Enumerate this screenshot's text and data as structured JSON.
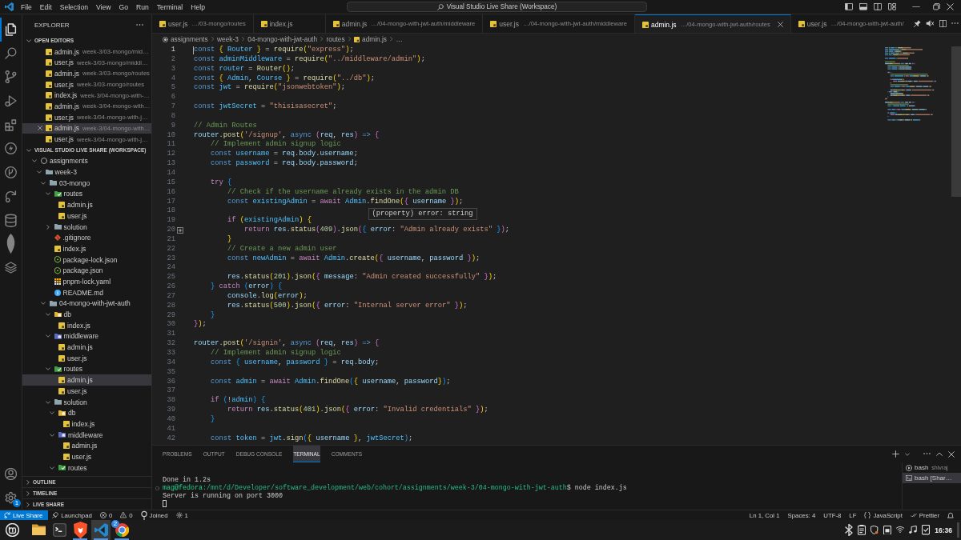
{
  "title_bar": {
    "menu": [
      "File",
      "Edit",
      "Selection",
      "View",
      "Go",
      "Run",
      "Terminal",
      "Help"
    ],
    "command_center": "Visual Studio Live Share (Workspace)"
  },
  "activity_bar": {
    "items": [
      {
        "selected": true
      },
      {
        "selected": false
      },
      {
        "selected": false
      },
      {
        "selected": false
      },
      {
        "selected": false
      },
      {
        "selected": false
      },
      {
        "selected": false
      },
      {
        "selected": false
      },
      {
        "selected": false
      },
      {
        "selected": false
      },
      {
        "selected": false
      }
    ],
    "settings_badge": "1"
  },
  "sidebar": {
    "title": "EXPLORER",
    "open_editors": {
      "title": "OPEN EDITORS",
      "expanded": true,
      "items": [
        {
          "name": "admin.js",
          "path": "week-3/03-mongo/mid…",
          "selected": false
        },
        {
          "name": "user.js",
          "path": "week-3/03-mongo/middl…",
          "selected": false
        },
        {
          "name": "admin.js",
          "path": "week-3/03-mongo/routes",
          "selected": false
        },
        {
          "name": "user.js",
          "path": "week-3/03-mongo/routes",
          "selected": false
        },
        {
          "name": "index.js",
          "path": "week-3/04-mongo-with-…",
          "selected": false
        },
        {
          "name": "admin.js",
          "path": "week-3/04-mongo-with…",
          "selected": false
        },
        {
          "name": "user.js",
          "path": "week-3/04-mongo-with-j…",
          "selected": false
        },
        {
          "name": "admin.js",
          "path": "week-3/04-mongo-with…",
          "selected": true
        },
        {
          "name": "user.js",
          "path": "week-3/04-mongo-with-j…",
          "selected": false
        }
      ]
    },
    "workspace": {
      "title": "VISUAL STUDIO LIVE SHARE (WORKSPACE)",
      "expanded": true,
      "tree": [
        {
          "name": "assignments",
          "kind": "root",
          "expanded": true,
          "selected": false,
          "children": [
            {
              "name": "week-3",
              "kind": "folder",
              "expanded": true,
              "selected": false,
              "children": [
                {
                  "name": "03-mongo",
                  "kind": "folder",
                  "expanded": true,
                  "selected": false,
                  "children": [
                    {
                      "name": "routes",
                      "kind": "routes",
                      "expanded": true,
                      "selected": false,
                      "children": [
                        {
                          "name": "admin.js",
                          "kind": "js",
                          "selected": false
                        },
                        {
                          "name": "user.js",
                          "kind": "js",
                          "selected": false
                        }
                      ]
                    },
                    {
                      "name": "solution",
                      "kind": "folder",
                      "expanded": false,
                      "selected": false
                    },
                    {
                      "name": ".gitignore",
                      "kind": "git",
                      "selected": false
                    },
                    {
                      "name": "index.js",
                      "kind": "js",
                      "selected": false
                    },
                    {
                      "name": "package-lock.json",
                      "kind": "npm",
                      "selected": false
                    },
                    {
                      "name": "package.json",
                      "kind": "npm",
                      "selected": false
                    },
                    {
                      "name": "pnpm-lock.yaml",
                      "kind": "pnpm",
                      "selected": false
                    },
                    {
                      "name": "README.md",
                      "kind": "info",
                      "selected": false
                    }
                  ]
                },
                {
                  "name": "04-mongo-with-jwt-auth",
                  "kind": "folder",
                  "expanded": true,
                  "selected": false,
                  "children": [
                    {
                      "name": "db",
                      "kind": "db",
                      "expanded": true,
                      "selected": false,
                      "children": [
                        {
                          "name": "index.js",
                          "kind": "js",
                          "selected": false
                        }
                      ]
                    },
                    {
                      "name": "middleware",
                      "kind": "middleware",
                      "expanded": true,
                      "selected": false,
                      "children": [
                        {
                          "name": "admin.js",
                          "kind": "js",
                          "selected": false
                        },
                        {
                          "name": "user.js",
                          "kind": "js",
                          "selected": false
                        }
                      ]
                    },
                    {
                      "name": "routes",
                      "kind": "routes",
                      "expanded": true,
                      "selected": false,
                      "children": [
                        {
                          "name": "admin.js",
                          "kind": "js",
                          "selected": true
                        },
                        {
                          "name": "user.js",
                          "kind": "js",
                          "selected": false
                        }
                      ]
                    },
                    {
                      "name": "solution",
                      "kind": "folder",
                      "expanded": true,
                      "selected": false,
                      "children": [
                        {
                          "name": "db",
                          "kind": "db",
                          "expanded": true,
                          "selected": false,
                          "children": [
                            {
                              "name": "index.js",
                              "kind": "js",
                              "selected": false
                            }
                          ]
                        },
                        {
                          "name": "middleware",
                          "kind": "middleware",
                          "expanded": true,
                          "selected": false,
                          "children": [
                            {
                              "name": "admin.js",
                              "kind": "js",
                              "selected": false
                            },
                            {
                              "name": "user.js",
                              "kind": "js",
                              "selected": false
                            }
                          ]
                        },
                        {
                          "name": "routes",
                          "kind": "routes",
                          "expanded": true,
                          "selected": false
                        }
                      ]
                    }
                  ]
                }
              ]
            }
          ]
        }
      ]
    },
    "more_sections": [
      {
        "title": "OUTLINE",
        "expanded": false
      },
      {
        "title": "TIMELINE",
        "expanded": false
      },
      {
        "title": "LIVE SHARE",
        "expanded": false
      }
    ]
  },
  "editor": {
    "tabs": [
      {
        "name": "user.js",
        "path": "…/03-mongo/routes",
        "selected": false
      },
      {
        "name": "index.js",
        "selected": false
      },
      {
        "name": "admin.js",
        "path": "…/04-mongo-with-jwt-auth/middleware",
        "selected": false
      },
      {
        "name": "user.js",
        "path": "…/04-mongo-with-jwt-auth/middleware",
        "selected": false
      },
      {
        "name": "admin.js",
        "path": "…/04-mongo-with-jwt-auth/routes",
        "selected": true
      },
      {
        "name": "user.js",
        "path": "…/04-mongo-with-jwt-auth/",
        "selected": false
      }
    ],
    "breadcrumbs": [
      {
        "text": "assignments",
        "kind": "root"
      },
      {
        "text": "week-3",
        "kind": "folder"
      },
      {
        "text": "04-mongo-with-jwt-auth",
        "kind": "folder"
      },
      {
        "text": "routes",
        "kind": "folder"
      },
      {
        "text": "admin.js",
        "kind": "js"
      },
      {
        "text": "…",
        "kind": "symbol"
      }
    ],
    "lines": [
      {
        "number": "1",
        "active": true,
        "gutter_add": false,
        "tokens": [
          {
            "kind": "keyword",
            "text": "const "
          },
          {
            "kind": "bracket1",
            "text": "{ "
          },
          {
            "kind": "constant",
            "text": "Router "
          },
          {
            "kind": "bracket1",
            "text": "}"
          },
          {
            "kind": "plain",
            "text": " = "
          },
          {
            "kind": "function",
            "text": "require"
          },
          {
            "kind": "bracket1",
            "text": "("
          },
          {
            "kind": "string",
            "text": "\"express\""
          },
          {
            "kind": "bracket1",
            "text": ")"
          },
          {
            "kind": "plain",
            "text": ";"
          }
        ]
      },
      {
        "number": "2",
        "active": false,
        "gutter_add": false,
        "tokens": [
          {
            "kind": "keyword",
            "text": "const "
          },
          {
            "kind": "constant",
            "text": "adminMiddleware"
          },
          {
            "kind": "plain",
            "text": " = "
          },
          {
            "kind": "function",
            "text": "require"
          },
          {
            "kind": "bracket1",
            "text": "("
          },
          {
            "kind": "string",
            "text": "\"../middleware/admin\""
          },
          {
            "kind": "bracket1",
            "text": ")"
          },
          {
            "kind": "plain",
            "text": ";"
          }
        ]
      },
      {
        "number": "3",
        "active": false,
        "gutter_add": false,
        "tokens": [
          {
            "kind": "keyword",
            "text": "const "
          },
          {
            "kind": "constant",
            "text": "router"
          },
          {
            "kind": "plain",
            "text": " = "
          },
          {
            "kind": "function",
            "text": "Router"
          },
          {
            "kind": "bracket1",
            "text": "()"
          },
          {
            "kind": "plain",
            "text": ";"
          }
        ]
      },
      {
        "number": "4",
        "active": false,
        "gutter_add": false,
        "tokens": [
          {
            "kind": "keyword",
            "text": "const "
          },
          {
            "kind": "bracket1",
            "text": "{ "
          },
          {
            "kind": "constant",
            "text": "Admin"
          },
          {
            "kind": "plain",
            "text": ", "
          },
          {
            "kind": "constant",
            "text": "Course "
          },
          {
            "kind": "bracket1",
            "text": "}"
          },
          {
            "kind": "plain",
            "text": " = "
          },
          {
            "kind": "function",
            "text": "require"
          },
          {
            "kind": "bracket1",
            "text": "("
          },
          {
            "kind": "string",
            "text": "\"../db\""
          },
          {
            "kind": "bracket1",
            "text": ")"
          },
          {
            "kind": "plain",
            "text": ";"
          }
        ]
      },
      {
        "number": "5",
        "active": false,
        "gutter_add": false,
        "tokens": [
          {
            "kind": "keyword",
            "text": "const "
          },
          {
            "kind": "constant",
            "text": "jwt"
          },
          {
            "kind": "plain",
            "text": " = "
          },
          {
            "kind": "function",
            "text": "require"
          },
          {
            "kind": "bracket1",
            "text": "("
          },
          {
            "kind": "string",
            "text": "\"jsonwebtoken\""
          },
          {
            "kind": "bracket1",
            "text": ")"
          },
          {
            "kind": "plain",
            "text": ";"
          }
        ]
      },
      {
        "number": "6",
        "active": false,
        "gutter_add": false
      },
      {
        "number": "7",
        "active": false,
        "gutter_add": false,
        "tokens": [
          {
            "kind": "keyword",
            "text": "const "
          },
          {
            "kind": "constant",
            "text": "jwtSecret"
          },
          {
            "kind": "plain",
            "text": " = "
          },
          {
            "kind": "string",
            "text": "\"thisisasecret\""
          },
          {
            "kind": "plain",
            "text": ";"
          }
        ]
      },
      {
        "number": "8",
        "active": false,
        "gutter_add": false
      },
      {
        "number": "9",
        "active": false,
        "gutter_add": false,
        "tokens": [
          {
            "kind": "comment",
            "text": "// Admin Routes"
          }
        ]
      },
      {
        "number": "10",
        "active": false,
        "gutter_add": false,
        "tokens": [
          {
            "kind": "variable",
            "text": "router"
          },
          {
            "kind": "plain",
            "text": "."
          },
          {
            "kind": "function",
            "text": "post"
          },
          {
            "kind": "bracket1",
            "text": "("
          },
          {
            "kind": "string",
            "text": "'/signup'"
          },
          {
            "kind": "plain",
            "text": ", "
          },
          {
            "kind": "keyword",
            "text": "async "
          },
          {
            "kind": "bracket2",
            "text": "("
          },
          {
            "kind": "variable",
            "text": "req"
          },
          {
            "kind": "plain",
            "text": ", "
          },
          {
            "kind": "variable",
            "text": "res"
          },
          {
            "kind": "bracket2",
            "text": ") "
          },
          {
            "kind": "keyword",
            "text": "=> "
          },
          {
            "kind": "bracket2",
            "text": "{"
          }
        ]
      },
      {
        "number": "11",
        "active": false,
        "gutter_add": false,
        "tokens": [
          {
            "kind": "comment",
            "text": "    // Implement admin signup logic"
          }
        ]
      },
      {
        "number": "12",
        "active": false,
        "gutter_add": false,
        "tokens": [
          {
            "kind": "keyword",
            "text": "    const "
          },
          {
            "kind": "constant",
            "text": "username"
          },
          {
            "kind": "plain",
            "text": " = "
          },
          {
            "kind": "variable",
            "text": "req"
          },
          {
            "kind": "plain",
            "text": "."
          },
          {
            "kind": "variable",
            "text": "body"
          },
          {
            "kind": "plain",
            "text": "."
          },
          {
            "kind": "variable",
            "text": "username"
          },
          {
            "kind": "plain",
            "text": ";"
          }
        ]
      },
      {
        "number": "13",
        "active": false,
        "gutter_add": false,
        "tokens": [
          {
            "kind": "keyword",
            "text": "    const "
          },
          {
            "kind": "constant",
            "text": "password"
          },
          {
            "kind": "plain",
            "text": " = "
          },
          {
            "kind": "variable",
            "text": "req"
          },
          {
            "kind": "plain",
            "text": "."
          },
          {
            "kind": "variable",
            "text": "body"
          },
          {
            "kind": "plain",
            "text": "."
          },
          {
            "kind": "variable",
            "text": "password"
          },
          {
            "kind": "plain",
            "text": ";"
          }
        ]
      },
      {
        "number": "14",
        "active": false,
        "gutter_add": false
      },
      {
        "number": "15",
        "active": false,
        "gutter_add": false,
        "tokens": [
          {
            "kind": "control",
            "text": "    try "
          },
          {
            "kind": "bracket3",
            "text": "{"
          }
        ]
      },
      {
        "number": "16",
        "active": false,
        "gutter_add": false,
        "tokens": [
          {
            "kind": "comment",
            "text": "        // Check if the username already exists in the admin DB"
          }
        ]
      },
      {
        "number": "17",
        "active": false,
        "gutter_add": false,
        "tokens": [
          {
            "kind": "keyword",
            "text": "        const "
          },
          {
            "kind": "constant",
            "text": "existingAdmin"
          },
          {
            "kind": "plain",
            "text": " = "
          },
          {
            "kind": "control",
            "text": "await "
          },
          {
            "kind": "constant",
            "text": "Admin"
          },
          {
            "kind": "plain",
            "text": "."
          },
          {
            "kind": "function",
            "text": "findOne"
          },
          {
            "kind": "bracket1",
            "text": "("
          },
          {
            "kind": "bracket2",
            "text": "{ "
          },
          {
            "kind": "variable",
            "text": "username "
          },
          {
            "kind": "bracket2",
            "text": "}"
          },
          {
            "kind": "bracket1",
            "text": ")"
          },
          {
            "kind": "plain",
            "text": ";"
          }
        ]
      },
      {
        "number": "18",
        "active": false,
        "gutter_add": false
      },
      {
        "number": "19",
        "active": false,
        "gutter_add": false,
        "tokens": [
          {
            "kind": "control",
            "text": "        if "
          },
          {
            "kind": "bracket1",
            "text": "("
          },
          {
            "kind": "constant",
            "text": "existingAdmin"
          },
          {
            "kind": "bracket1",
            "text": ") "
          },
          {
            "kind": "bracket1",
            "text": "{"
          }
        ]
      },
      {
        "number": "20",
        "active": false,
        "gutter_add": true,
        "tokens": [
          {
            "kind": "control",
            "text": "            return "
          },
          {
            "kind": "variable",
            "text": "res"
          },
          {
            "kind": "plain",
            "text": "."
          },
          {
            "kind": "function",
            "text": "status"
          },
          {
            "kind": "bracket2",
            "text": "("
          },
          {
            "kind": "number",
            "text": "409"
          },
          {
            "kind": "bracket2",
            "text": ")"
          },
          {
            "kind": "plain",
            "text": "."
          },
          {
            "kind": "function",
            "text": "json"
          },
          {
            "kind": "bracket2",
            "text": "("
          },
          {
            "kind": "bracket3",
            "text": "{ "
          },
          {
            "kind": "variable",
            "text": "error",
            "hover": "(property) error: string"
          },
          {
            "kind": "plain",
            "text": ": "
          },
          {
            "kind": "string",
            "text": "\"Admin already exists\" "
          },
          {
            "kind": "bracket3",
            "text": "}"
          },
          {
            "kind": "bracket2",
            "text": ")"
          },
          {
            "kind": "plain",
            "text": ";"
          }
        ]
      },
      {
        "number": "21",
        "active": false,
        "gutter_add": false,
        "tokens": [
          {
            "kind": "bracket1",
            "text": "        }"
          }
        ]
      },
      {
        "number": "22",
        "active": false,
        "gutter_add": false,
        "tokens": [
          {
            "kind": "comment",
            "text": "        // Create a new admin user"
          }
        ]
      },
      {
        "number": "23",
        "active": false,
        "gutter_add": false,
        "tokens": [
          {
            "kind": "keyword",
            "text": "        const "
          },
          {
            "kind": "constant",
            "text": "newAdmin"
          },
          {
            "kind": "plain",
            "text": " = "
          },
          {
            "kind": "control",
            "text": "await "
          },
          {
            "kind": "constant",
            "text": "Admin"
          },
          {
            "kind": "plain",
            "text": "."
          },
          {
            "kind": "function",
            "text": "create"
          },
          {
            "kind": "bracket1",
            "text": "("
          },
          {
            "kind": "bracket2",
            "text": "{ "
          },
          {
            "kind": "variable",
            "text": "username"
          },
          {
            "kind": "plain",
            "text": ", "
          },
          {
            "kind": "variable",
            "text": "password "
          },
          {
            "kind": "bracket2",
            "text": "}"
          },
          {
            "kind": "bracket1",
            "text": ")"
          },
          {
            "kind": "plain",
            "text": ";"
          }
        ]
      },
      {
        "number": "24",
        "active": false,
        "gutter_add": false
      },
      {
        "number": "25",
        "active": false,
        "gutter_add": false,
        "tokens": [
          {
            "kind": "variable",
            "text": "        res"
          },
          {
            "kind": "plain",
            "text": "."
          },
          {
            "kind": "function",
            "text": "status"
          },
          {
            "kind": "bracket1",
            "text": "("
          },
          {
            "kind": "number",
            "text": "201"
          },
          {
            "kind": "bracket1",
            "text": ")"
          },
          {
            "kind": "plain",
            "text": "."
          },
          {
            "kind": "function",
            "text": "json"
          },
          {
            "kind": "bracket1",
            "text": "("
          },
          {
            "kind": "bracket2",
            "text": "{ "
          },
          {
            "kind": "variable",
            "text": "message"
          },
          {
            "kind": "plain",
            "text": ": "
          },
          {
            "kind": "string",
            "text": "\"Admin created successfully\" "
          },
          {
            "kind": "bracket2",
            "text": "}"
          },
          {
            "kind": "bracket1",
            "text": ")"
          },
          {
            "kind": "plain",
            "text": ";"
          }
        ]
      },
      {
        "number": "26",
        "active": false,
        "gutter_add": false,
        "tokens": [
          {
            "kind": "bracket3",
            "text": "    } "
          },
          {
            "kind": "control",
            "text": "catch "
          },
          {
            "kind": "bracket3",
            "text": "("
          },
          {
            "kind": "variable",
            "text": "error"
          },
          {
            "kind": "bracket3",
            "text": ") "
          },
          {
            "kind": "bracket3",
            "text": "{"
          }
        ]
      },
      {
        "number": "27",
        "active": false,
        "gutter_add": false,
        "tokens": [
          {
            "kind": "variable",
            "text": "        console"
          },
          {
            "kind": "plain",
            "text": "."
          },
          {
            "kind": "function",
            "text": "log"
          },
          {
            "kind": "bracket1",
            "text": "("
          },
          {
            "kind": "variable",
            "text": "error"
          },
          {
            "kind": "bracket1",
            "text": ")"
          },
          {
            "kind": "plain",
            "text": ";"
          }
        ]
      },
      {
        "number": "28",
        "active": false,
        "gutter_add": false,
        "tokens": [
          {
            "kind": "variable",
            "text": "        res"
          },
          {
            "kind": "plain",
            "text": "."
          },
          {
            "kind": "function",
            "text": "status"
          },
          {
            "kind": "bracket1",
            "text": "("
          },
          {
            "kind": "number",
            "text": "500"
          },
          {
            "kind": "bracket1",
            "text": ")"
          },
          {
            "kind": "plain",
            "text": "."
          },
          {
            "kind": "function",
            "text": "json"
          },
          {
            "kind": "bracket1",
            "text": "("
          },
          {
            "kind": "bracket2",
            "text": "{ "
          },
          {
            "kind": "variable",
            "text": "error"
          },
          {
            "kind": "plain",
            "text": ": "
          },
          {
            "kind": "string",
            "text": "\"Internal server error\" "
          },
          {
            "kind": "bracket2",
            "text": "}"
          },
          {
            "kind": "bracket1",
            "text": ")"
          },
          {
            "kind": "plain",
            "text": ";"
          }
        ]
      },
      {
        "number": "29",
        "active": false,
        "gutter_add": false,
        "tokens": [
          {
            "kind": "bracket3",
            "text": "    }"
          }
        ]
      },
      {
        "number": "30",
        "active": false,
        "gutter_add": false,
        "tokens": [
          {
            "kind": "bracket2",
            "text": "}"
          },
          {
            "kind": "bracket1",
            "text": ")"
          },
          {
            "kind": "plain",
            "text": ";"
          }
        ]
      },
      {
        "number": "31",
        "active": false,
        "gutter_add": false
      },
      {
        "number": "32",
        "active": false,
        "gutter_add": false,
        "tokens": [
          {
            "kind": "variable",
            "text": "router"
          },
          {
            "kind": "plain",
            "text": "."
          },
          {
            "kind": "function",
            "text": "post"
          },
          {
            "kind": "bracket1",
            "text": "("
          },
          {
            "kind": "string",
            "text": "'/signin'"
          },
          {
            "kind": "plain",
            "text": ", "
          },
          {
            "kind": "keyword",
            "text": "async "
          },
          {
            "kind": "bracket2",
            "text": "("
          },
          {
            "kind": "variable",
            "text": "req"
          },
          {
            "kind": "plain",
            "text": ", "
          },
          {
            "kind": "variable",
            "text": "res"
          },
          {
            "kind": "bracket2",
            "text": ") "
          },
          {
            "kind": "keyword",
            "text": "=> "
          },
          {
            "kind": "bracket2",
            "text": "{"
          }
        ]
      },
      {
        "number": "33",
        "active": false,
        "gutter_add": false,
        "tokens": [
          {
            "kind": "comment",
            "text": "    // Implement admin signup logic"
          }
        ]
      },
      {
        "number": "34",
        "active": false,
        "gutter_add": false,
        "tokens": [
          {
            "kind": "keyword",
            "text": "    const "
          },
          {
            "kind": "bracket3",
            "text": "{ "
          },
          {
            "kind": "constant",
            "text": "username"
          },
          {
            "kind": "plain",
            "text": ", "
          },
          {
            "kind": "constant",
            "text": "password "
          },
          {
            "kind": "bracket3",
            "text": "}"
          },
          {
            "kind": "plain",
            "text": " = "
          },
          {
            "kind": "variable",
            "text": "req"
          },
          {
            "kind": "plain",
            "text": "."
          },
          {
            "kind": "variable",
            "text": "body"
          },
          {
            "kind": "plain",
            "text": ";"
          }
        ]
      },
      {
        "number": "35",
        "active": false,
        "gutter_add": false
      },
      {
        "number": "36",
        "active": false,
        "gutter_add": false,
        "tokens": [
          {
            "kind": "keyword",
            "text": "    const "
          },
          {
            "kind": "constant",
            "text": "admin"
          },
          {
            "kind": "plain",
            "text": " = "
          },
          {
            "kind": "control",
            "text": "await "
          },
          {
            "kind": "constant",
            "text": "Admin"
          },
          {
            "kind": "plain",
            "text": "."
          },
          {
            "kind": "function",
            "text": "findOne"
          },
          {
            "kind": "bracket3",
            "text": "("
          },
          {
            "kind": "bracket1",
            "text": "{ "
          },
          {
            "kind": "variable",
            "text": "username"
          },
          {
            "kind": "plain",
            "text": ", "
          },
          {
            "kind": "variable",
            "text": "password"
          },
          {
            "kind": "bracket1",
            "text": "}"
          },
          {
            "kind": "bracket3",
            "text": ")"
          },
          {
            "kind": "plain",
            "text": ";"
          }
        ]
      },
      {
        "number": "37",
        "active": false,
        "gutter_add": false
      },
      {
        "number": "38",
        "active": false,
        "gutter_add": false,
        "tokens": [
          {
            "kind": "control",
            "text": "    if "
          },
          {
            "kind": "bracket3",
            "text": "("
          },
          {
            "kind": "plain",
            "text": "!"
          },
          {
            "kind": "constant",
            "text": "admin"
          },
          {
            "kind": "bracket3",
            "text": ") "
          },
          {
            "kind": "bracket3",
            "text": "{"
          }
        ]
      },
      {
        "number": "39",
        "active": false,
        "gutter_add": false,
        "tokens": [
          {
            "kind": "control",
            "text": "        return "
          },
          {
            "kind": "variable",
            "text": "res"
          },
          {
            "kind": "plain",
            "text": "."
          },
          {
            "kind": "function",
            "text": "status"
          },
          {
            "kind": "bracket1",
            "text": "("
          },
          {
            "kind": "number",
            "text": "401"
          },
          {
            "kind": "bracket1",
            "text": ")"
          },
          {
            "kind": "plain",
            "text": "."
          },
          {
            "kind": "function",
            "text": "json"
          },
          {
            "kind": "bracket1",
            "text": "("
          },
          {
            "kind": "bracket2",
            "text": "{ "
          },
          {
            "kind": "variable",
            "text": "error"
          },
          {
            "kind": "plain",
            "text": ": "
          },
          {
            "kind": "string",
            "text": "\"Invalid credentials\" "
          },
          {
            "kind": "bracket2",
            "text": "}"
          },
          {
            "kind": "bracket1",
            "text": ")"
          },
          {
            "kind": "plain",
            "text": ";"
          }
        ]
      },
      {
        "number": "40",
        "active": false,
        "gutter_add": false,
        "tokens": [
          {
            "kind": "bracket3",
            "text": "    }"
          }
        ]
      },
      {
        "number": "41",
        "active": false,
        "gutter_add": false
      },
      {
        "number": "42",
        "active": false,
        "gutter_add": false,
        "tokens": [
          {
            "kind": "keyword",
            "text": "    const "
          },
          {
            "kind": "constant",
            "text": "token"
          },
          {
            "kind": "plain",
            "text": " = "
          },
          {
            "kind": "constant",
            "text": "jwt"
          },
          {
            "kind": "plain",
            "text": "."
          },
          {
            "kind": "function",
            "text": "sign"
          },
          {
            "kind": "bracket3",
            "text": "("
          },
          {
            "kind": "bracket1",
            "text": "{ "
          },
          {
            "kind": "variable",
            "text": "username "
          },
          {
            "kind": "bracket1",
            "text": "}"
          },
          {
            "kind": "plain",
            "text": ", "
          },
          {
            "kind": "constant",
            "text": "jwtSecret"
          },
          {
            "kind": "bracket3",
            "text": ")"
          },
          {
            "kind": "plain",
            "text": ";"
          }
        ]
      }
    ]
  },
  "panel": {
    "tabs": [
      {
        "label": "PROBLEMS",
        "selected": false
      },
      {
        "label": "OUTPUT",
        "selected": false
      },
      {
        "label": "DEBUG CONSOLE",
        "selected": false
      },
      {
        "label": "TERMINAL",
        "selected": true
      },
      {
        "label": "COMMENTS",
        "selected": false
      }
    ],
    "terminal": {
      "lines": [
        {
          "decorated": false,
          "segments": [
            {
              "kind": "output",
              "text": "Done in 1.2s"
            }
          ]
        },
        {
          "decorated": true,
          "segments": [
            {
              "kind": "user",
              "text": "mag@fedora"
            },
            {
              "kind": "path",
              "text": ":/mnt/d/Developer/software_development/web/cohort/assignments/week-3/04-mongo-with-jwt-auth"
            },
            {
              "kind": "output",
              "text": "$ node index.js"
            }
          ]
        },
        {
          "decorated": false,
          "segments": [
            {
              "kind": "output",
              "text": "Server is running on port 3000"
            }
          ]
        }
      ]
    },
    "terminals": [
      {
        "name": "bash",
        "detail": "shivraj",
        "kind": "shared",
        "selected": false
      },
      {
        "name": "bash [Shar…",
        "kind": "shell",
        "selected": true
      }
    ]
  },
  "status_bar": {
    "left": [
      {
        "kind": "remote",
        "text": "Live Share"
      },
      {
        "kind": "launchpad",
        "text": "Launchpad"
      },
      {
        "kind": "errors",
        "text": "0"
      },
      {
        "kind": "warnings",
        "text": "0"
      },
      {
        "kind": "joined",
        "text": "Joined"
      },
      {
        "kind": "ports",
        "text": "1"
      }
    ],
    "right": [
      {
        "kind": "plain",
        "text": "Ln 1, Col 1"
      },
      {
        "kind": "plain",
        "text": "Spaces: 4"
      },
      {
        "kind": "plain",
        "text": "UTF-8"
      },
      {
        "kind": "plain",
        "text": "LF"
      },
      {
        "kind": "language",
        "text": "JavaScript"
      },
      {
        "kind": "formatter",
        "text": "Prettier"
      },
      {
        "kind": "bell"
      }
    ]
  },
  "taskbar": {
    "apps": [
      {
        "kind": "folder",
        "running": false,
        "selected": false
      },
      {
        "kind": "terminal",
        "running": false,
        "selected": false
      },
      {
        "kind": "shield",
        "running": true,
        "selected": false
      },
      {
        "kind": "ribbon",
        "running": true,
        "selected": true
      },
      {
        "kind": "wheel",
        "running": true,
        "selected": false,
        "badge": "2"
      }
    ],
    "clock": "16:36"
  }
}
